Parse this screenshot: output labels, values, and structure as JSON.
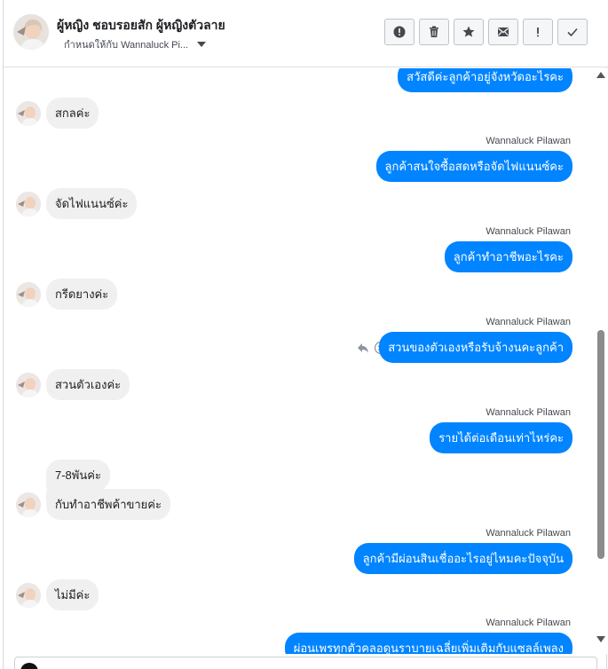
{
  "header": {
    "name": "ผู้หญิง ชอบรอยสัก ผู้หญิงตัวลาย",
    "assigned_to": "กำหนดให้กับ Wannaluck Pi..."
  },
  "toolbar": {
    "icons": [
      "alert-circle-icon",
      "trash-icon",
      "star-icon",
      "mail-icon",
      "exclamation-icon",
      "check-icon"
    ]
  },
  "conversation": {
    "agent_name": "Wannaluck Pilawan",
    "messages": [
      {
        "dir": "out",
        "text": "สวัสดีค่ะลูกค้าอยู่จังหวัดอะไรคะ"
      },
      {
        "dir": "in",
        "text": "สกลค่ะ"
      },
      {
        "dir": "out",
        "sender": "Wannaluck Pilawan",
        "text": "ลูกค้าสนใจซื้อสดหรือจัดไฟแนนซ์คะ"
      },
      {
        "dir": "in",
        "text": "จัดไฟแนนซ์ค่ะ"
      },
      {
        "dir": "out",
        "sender": "Wannaluck Pilawan",
        "text": "ลูกค้าทำอาชีพอะไรคะ"
      },
      {
        "dir": "in",
        "text": "กรีดยางค่ะ"
      },
      {
        "dir": "out",
        "sender": "Wannaluck Pilawan",
        "text": "สวนของตัวเองหรือรับจ้างนคะลูกค้า"
      },
      {
        "dir": "in",
        "text": "สวนตัวเองค่ะ"
      },
      {
        "dir": "out",
        "sender": "Wannaluck Pilawan",
        "text": "รายได้ต่อเดือนเท่าไหร่คะ"
      },
      {
        "dir": "in",
        "text": "7-8พันค่ะ"
      },
      {
        "dir": "in",
        "text": "กับทำอาชีพค้าขายค่ะ"
      },
      {
        "dir": "out",
        "sender": "Wannaluck Pilawan",
        "text": "ลูกค้ามีผ่อนสินเชื่ออะไรอยู่ไหมคะปัจจุบัน"
      },
      {
        "dir": "in",
        "text": "ไม่มีค่ะ"
      },
      {
        "dir": "out",
        "sender": "Wannaluck Pilawan",
        "text": "ผ่อนเพรทุกตัวคลอดูนราบายเฉลี่ยเพิ่มเติมกับแซลล์เพลง"
      }
    ]
  },
  "colors": {
    "outgoing_bubble": "#0084ff",
    "incoming_bubble": "#f1f0f0"
  }
}
